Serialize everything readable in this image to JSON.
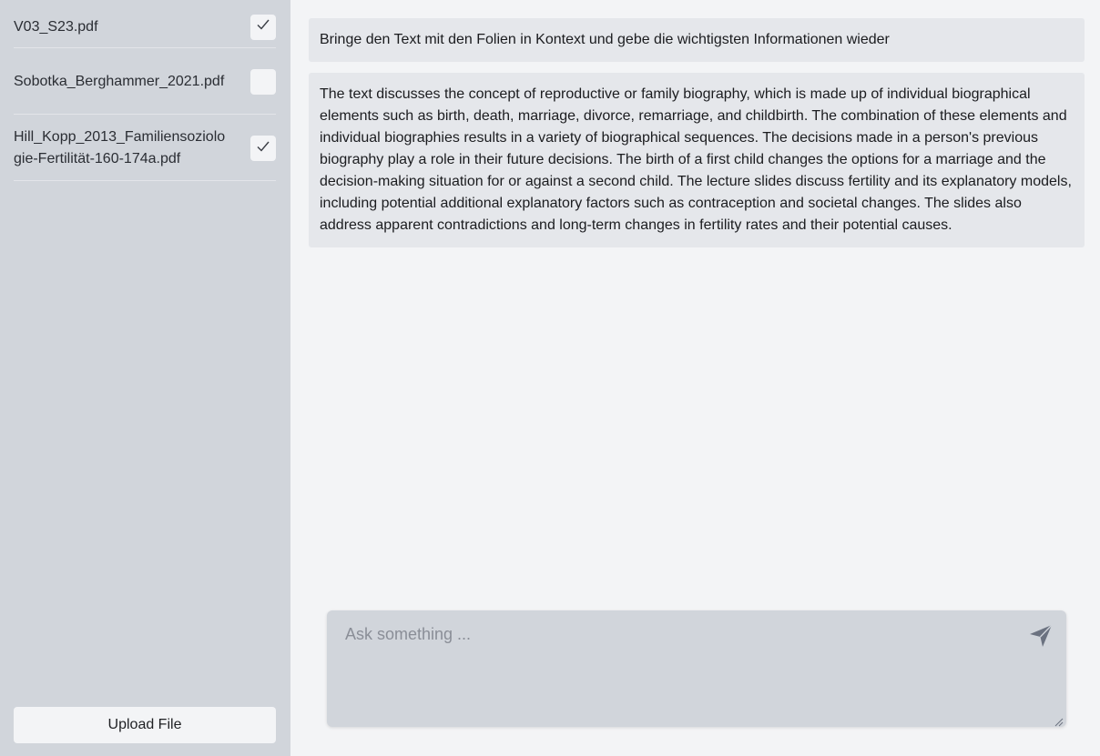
{
  "sidebar": {
    "files": [
      {
        "name": "V03_S23.pdf",
        "checked": true
      },
      {
        "name": "Sobotka_Berghammer_2021.pdf",
        "checked": false
      },
      {
        "name": "Hill_Kopp_2013_Familiensoziologie-Fertilität-160-174a.pdf",
        "checked": true
      }
    ],
    "checkmark": "✓",
    "upload_label": "Upload File"
  },
  "chat": {
    "messages": [
      {
        "role": "user",
        "text": "Bringe den Text mit den Folien in Kontext und gebe die wichtigsten Informationen wieder"
      },
      {
        "role": "assistant",
        "text": "The text discusses the concept of reproductive or family biography, which is made up of individual biographical elements such as birth, death, marriage, divorce, remarriage, and childbirth. The combination of these elements and individual biographies results in a variety of biographical sequences. The decisions made in a person's previous biography play a role in their future decisions. The birth of a first child changes the options for a marriage and the decision-making situation for or against a second child. The lecture slides discuss fertility and its explanatory models, including potential additional explanatory factors such as contraception and societal changes. The slides also address apparent contradictions and long-term changes in fertility rates and their potential causes."
      }
    ]
  },
  "composer": {
    "placeholder": "Ask something ...",
    "send_icon": "send-icon",
    "value": ""
  },
  "colors": {
    "sidebar_bg": "#d1d5db",
    "main_bg": "#f3f4f6",
    "message_bg": "#e5e7eb",
    "icon_color": "#6b7280"
  }
}
